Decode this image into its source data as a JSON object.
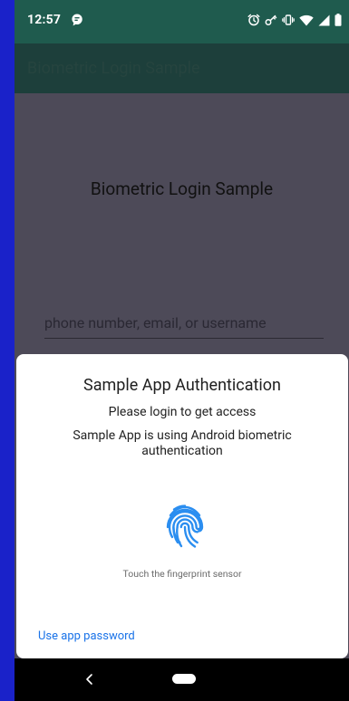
{
  "status_bar": {
    "time": "12:57",
    "left_icons": [
      "notification-bubble-icon"
    ],
    "right_icons": [
      "alarm-icon",
      "vpn-key-icon",
      "vibrate-icon",
      "wifi-icon",
      "cell-signal-icon",
      "battery-icon"
    ]
  },
  "app_bar": {
    "title": "Biometric Login Sample"
  },
  "content": {
    "heading": "Biometric Login Sample",
    "username_placeholder": "phone number, email, or username"
  },
  "biometric_prompt": {
    "title": "Sample App Authentication",
    "subtitle": "Please login to get access",
    "description": "Sample App is using Android biometric authentication",
    "icon": "fingerprint-icon",
    "hint": "Touch the fingerprint sensor",
    "negative_button": "Use app password"
  },
  "navigation": {
    "icons": [
      "back-icon",
      "home-pill-icon"
    ]
  },
  "colors": {
    "status_bar": "#1f5b4e",
    "app_bar": "#1d3f3b",
    "background": "#4d4a58",
    "accent": "#1a73e8",
    "frame": "#1a22c9"
  }
}
